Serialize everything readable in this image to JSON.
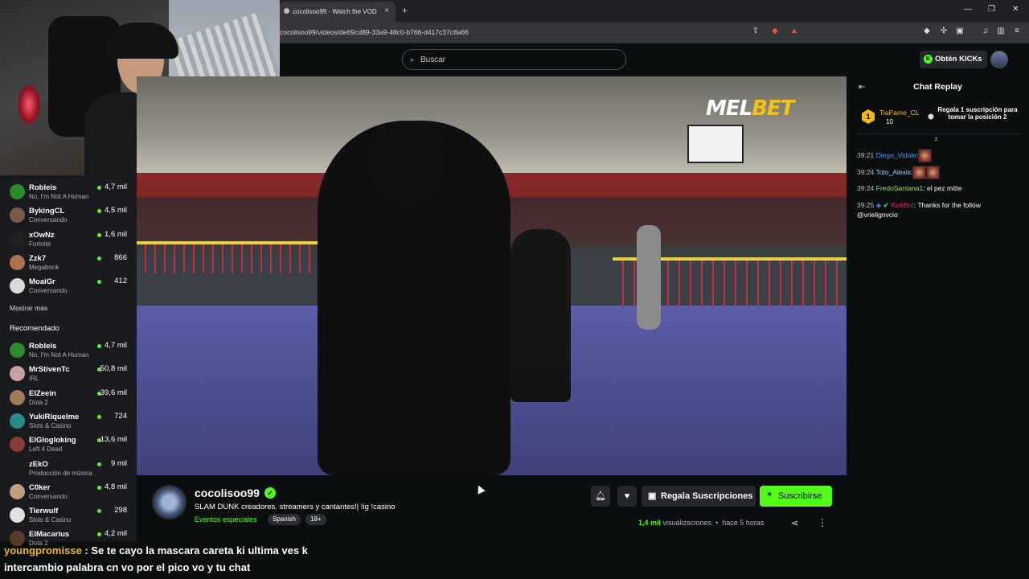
{
  "browser": {
    "tab_title": "cocolisoo99 - Watch the VOD",
    "tab_close": "×",
    "new_tab": "+",
    "url": "cocolisoo99/videos/de69cd89-33a9-48c0-b766-d417c37c8a66",
    "minimize": "—",
    "maximize": "❐",
    "close": "✕"
  },
  "header": {
    "search_placeholder": "Buscar",
    "get_kicks": "Obtén KICKs"
  },
  "sidebar": {
    "following": [
      {
        "name": "Robleis",
        "category": "No, I'm Not A Human",
        "viewers": "4,7 mil",
        "color": "#2c8a2c"
      },
      {
        "name": "BykingCL",
        "category": "Conversando",
        "viewers": "4,5 mil",
        "color": "#7a5a4a"
      },
      {
        "name": "xOwNz",
        "category": "Fortnite",
        "viewers": "1,6 mil",
        "color": "#222222"
      },
      {
        "name": "Zzk7",
        "category": "Megabonk",
        "viewers": "866",
        "color": "#b0704a"
      },
      {
        "name": "MoaiGr",
        "category": "Conversando",
        "viewers": "412",
        "color": "#d9d9d9"
      }
    ],
    "show_more": "Mostrar más",
    "recommended_title": "Recomendado",
    "recommended": [
      {
        "name": "Robleis",
        "category": "No, I'm Not A Human",
        "viewers": "4,7 mil",
        "color": "#2c8a2c"
      },
      {
        "name": "MrStivenTc",
        "category": "IRL",
        "viewers": "50,8 mil",
        "color": "#c9a0a0"
      },
      {
        "name": "ElZeein",
        "category": "Dota 2",
        "viewers": "39,6 mil",
        "color": "#a07a5a"
      },
      {
        "name": "YukiRiquelme",
        "category": "Slots & Casino",
        "viewers": "724",
        "color": "#2a8a8a"
      },
      {
        "name": "ElGlogloking",
        "category": "Left 4 Dead",
        "viewers": "13,6 mil",
        "color": "#8a3a3a"
      },
      {
        "name": "zEkO",
        "category": "Producción de música",
        "viewers": "9 mil",
        "color": "#1a1a1a"
      },
      {
        "name": "C0ker",
        "category": "Conversando",
        "viewers": "4,8 mil",
        "color": "#c0a080"
      },
      {
        "name": "Tierwulf",
        "category": "Slots & Casino",
        "viewers": "298",
        "color": "#e0e0e0"
      },
      {
        "name": "ElMacarius",
        "category": "Dota 2",
        "viewers": "4,2 mil",
        "color": "#5a3a2a"
      }
    ]
  },
  "video": {
    "sponsor_main": "MEL",
    "sponsor_accent": "BET"
  },
  "chat": {
    "title": "Chat Replay",
    "pinned": {
      "rank": "1",
      "user": "TiaPame_CL",
      "count": "10",
      "text": "Regala 1 suscripción para tomar la posición 2"
    },
    "messages": [
      {
        "time": "39:21",
        "user": "Diego_Vidale",
        "user_color": "#3d9df2",
        "text": ":",
        "emotes": 1
      },
      {
        "time": "39:24",
        "user": "Toto_Alexis",
        "user_color": "#8ed8f8",
        "text": ":",
        "emotes": 2
      },
      {
        "time": "39:24",
        "user": "FredoSantana1",
        "user_color": "#9ee070",
        "text": ": el pez mitte",
        "emotes": 0
      },
      {
        "time": "39:25",
        "user": "KickBot",
        "user_color": "#e0245e",
        "text": ": Thanks for the follow",
        "text2": "@vrielignvcio",
        "emotes": 0
      }
    ]
  },
  "channel": {
    "name": "cocolisoo99",
    "title": "SLAM DUNK creadores. streamers y cantantes!| !ig !casino",
    "category": "Eventos especiales",
    "tags": [
      "Spanish",
      "18+"
    ],
    "gift_button": "Regala Suscripciones",
    "subscribe_button": "Suscribirse",
    "views_count": "1,4 mil",
    "views_label": "visualizaciones",
    "time_ago": "hace 5 horas"
  },
  "overlay_chat": {
    "user": "youngpromisse",
    "line1": " : Se te cayo la mascara careta ki ultima ves k",
    "line2": "intercambio palabra cn vo por el pico vo y tu chat"
  },
  "colors": {
    "accent": "#53fc18",
    "background": "#0b0e0f",
    "sidebar": "#191b1f",
    "badge_gold": "#f2b81b"
  }
}
